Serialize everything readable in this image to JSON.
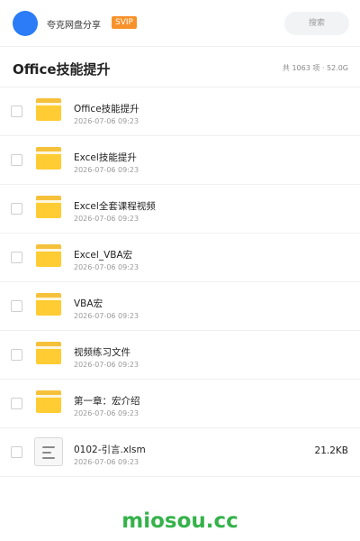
{
  "header": {
    "share_title": "夸克网盘分享",
    "badge": "SVIP",
    "search_label": "搜索"
  },
  "folder": {
    "title": "Office技能提升",
    "summary": "共 1063 项 · 52.0G"
  },
  "items": [
    {
      "type": "folder",
      "name": "Office技能提升",
      "date": "2026-07-06 09:23",
      "size": ""
    },
    {
      "type": "folder",
      "name": "Excel技能提升",
      "date": "2026-07-06 09:23",
      "size": ""
    },
    {
      "type": "folder",
      "name": "Excel全套课程视频",
      "date": "2026-07-06 09:23",
      "size": ""
    },
    {
      "type": "folder",
      "name": "Excel_VBA宏",
      "date": "2026-07-06 09:23",
      "size": ""
    },
    {
      "type": "folder",
      "name": "VBA宏",
      "date": "2026-07-06 09:23",
      "size": ""
    },
    {
      "type": "folder",
      "name": "视频练习文件",
      "date": "2026-07-06 09:23",
      "size": ""
    },
    {
      "type": "folder",
      "name": "第一章：宏介绍",
      "date": "2026-07-06 09:23",
      "size": ""
    },
    {
      "type": "file",
      "name": "0102-引言.xlsm",
      "date": "2026-07-06 09:23",
      "size": "21.2KB"
    }
  ],
  "watermark": "miosou.cc",
  "colors": {
    "accent_blue": "#2b7cf6",
    "svip_orange": "#f7922a",
    "folder_yellow": "#ffcc33",
    "watermark_green": "#35b24a"
  }
}
